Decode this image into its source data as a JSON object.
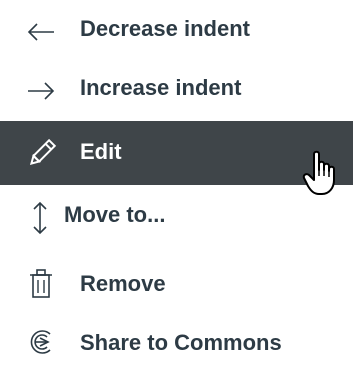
{
  "menu": {
    "items": [
      {
        "label": "Decrease indent",
        "icon": "arrow-left-icon"
      },
      {
        "label": "Increase indent",
        "icon": "arrow-right-icon"
      },
      {
        "label": "Edit",
        "icon": "pencil-icon",
        "active": true
      },
      {
        "label": "Move to...",
        "icon": "updown-arrow-icon"
      },
      {
        "label": "Remove",
        "icon": "trash-icon"
      },
      {
        "label": "Share to Commons",
        "icon": "share-commons-icon"
      }
    ]
  },
  "colors": {
    "text": "#2d3b45",
    "active_background": "#3f4549",
    "active_text": "#ffffff"
  }
}
